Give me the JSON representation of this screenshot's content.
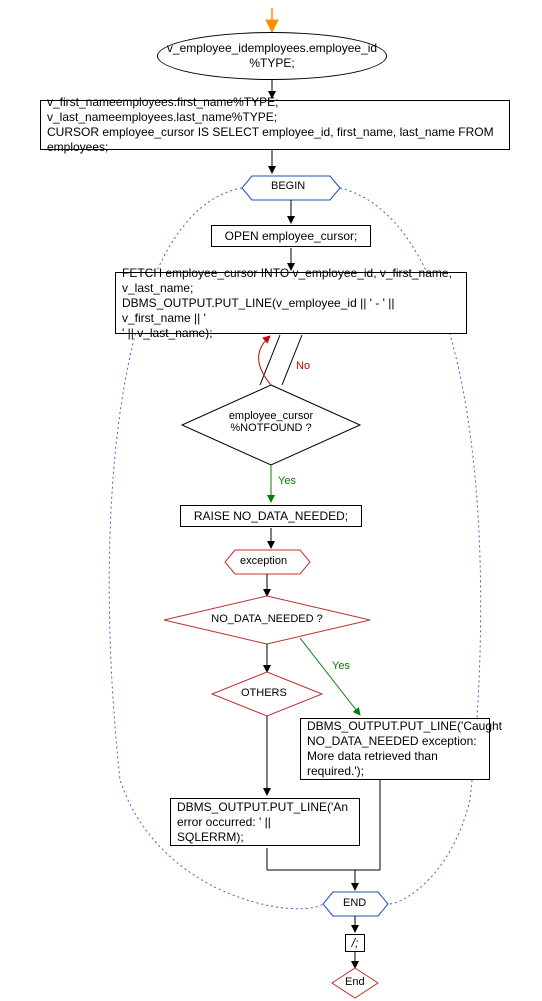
{
  "start_arrow_color": "#ff8c00",
  "nodes": {
    "declare_ellipse": "v_employee_idemployees.employee_id\n%TYPE;",
    "declare_block": "v_first_nameemployees.first_name%TYPE;\nv_last_nameemployees.last_name%TYPE;\nCURSOR employee_cursor IS SELECT employee_id, first_name, last_name FROM employees;",
    "begin": "BEGIN",
    "open_cursor": "OPEN employee_cursor;",
    "fetch_block": "FETCH employee_cursor INTO v_employee_id, v_first_name,\nv_last_name;\nDBMS_OUTPUT.PUT_LINE(v_employee_id || ' - ' || v_first_name || '\n' || v_last_name);",
    "notfound_cond": "employee_cursor\n%NOTFOUND ?",
    "raise_stmt": "RAISE NO_DATA_NEEDED;",
    "exception": "exception",
    "ndn_cond": "NO_DATA_NEEDED ?",
    "others_cond": "OTHERS",
    "ndn_handler": "DBMS_OUTPUT.PUT_LINE('Caught\nNO_DATA_NEEDED exception:\nMore data retrieved than\nrequired.');",
    "others_handler": "DBMS_OUTPUT.PUT_LINE('An\nerror occurred: ' ||\nSQLERRM);",
    "end": "END",
    "slash": "/;",
    "end_terminal": "End"
  },
  "labels": {
    "yes": "Yes",
    "no": "No"
  }
}
